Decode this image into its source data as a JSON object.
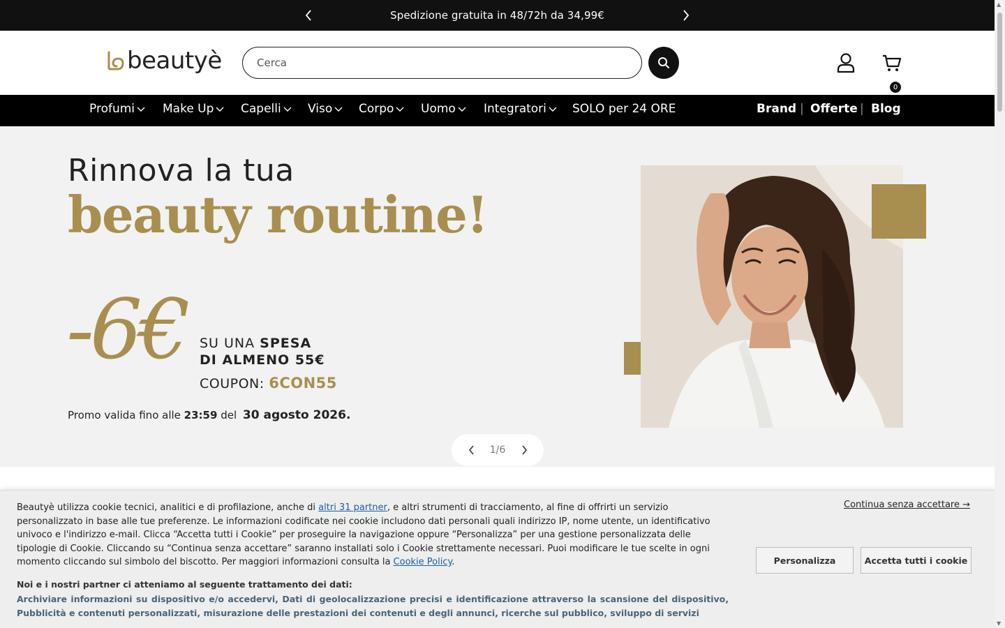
{
  "announcement": {
    "text": "Spedizione gratuita in 48/72h da 34,99€",
    "prev_icon": "chevron-left-icon",
    "next_icon": "chevron-right-icon"
  },
  "header": {
    "logo_text": "beautyè",
    "search_placeholder": "Cerca",
    "cart_count": "0"
  },
  "nav": {
    "items": [
      {
        "label": "Profumi",
        "dropdown": true
      },
      {
        "label": "Make Up",
        "dropdown": true
      },
      {
        "label": "Capelli",
        "dropdown": true
      },
      {
        "label": "Viso",
        "dropdown": true
      },
      {
        "label": "Corpo",
        "dropdown": true
      },
      {
        "label": "Uomo",
        "dropdown": true
      },
      {
        "label": "Integratori",
        "dropdown": true
      },
      {
        "label": "SOLO per 24 ORE",
        "dropdown": false
      }
    ],
    "right_links": [
      "Brand",
      "Offerte",
      "Blog"
    ]
  },
  "hero": {
    "headline": "Rinnova la tua",
    "headline_accent": "beauty routine!",
    "discount": "-6€",
    "line1_a": "SU UNA ",
    "line1_b": "SPESA",
    "line2": "DI ALMENO 55€",
    "coupon_label": "COUPON: ",
    "coupon_code": "6CON55",
    "promo_prefix": "Promo valida fino alle ",
    "promo_time": "23:59",
    "promo_mid": " del ",
    "promo_date": "30 agosto 2026.",
    "slide_indicator": "1/6",
    "accent_color": "#a88f4f"
  },
  "cookie_banner": {
    "text_before_link": "Beautyè utilizza cookie tecnici, analitici e di profilazione, anche di ",
    "partners_link": "altri 31 partner",
    "text_after_link": ", e altri strumenti di tracciamento, al fine di offrirti un servizio personalizzato in base alle tue preferenze. Le informazioni codificate nei cookie includono dati personali quali indirizzo IP, nome utente, un identificativo univoco e l'indirizzo e-mail. Clicca “Accetta tutti i Cookie” per proseguire la navigazione oppure “Personalizza” per una gestione personalizzata delle tipologie di Cookie. Cliccando su “Continua senza accettare” saranno installati solo i Cookie strettamente necessari. Puoi modificare le tue scelte in ogni momento cliccando sul simbolo del biscotto. Per maggiori informazioni consulta la ",
    "policy_link": "Cookie Policy",
    "text_end": ".",
    "purposes_title": "Noi e i nostri partner ci atteniamo al seguente trattamento dei dati:",
    "purposes": "Archiviare informazioni su dispositivo e/o accedervi, Dati di geolocalizzazione precisi e identificazione attraverso la scansione del dispositivo, Pubblicità e contenuti personalizzati, misurazione delle prestazioni dei contenuti e degli annunci, ricerche sul pubblico, sviluppo di servizi",
    "continue_label": "Continua senza accettare →",
    "customize_label": "Personalizza",
    "accept_label": "Accetta tutti i cookie"
  }
}
